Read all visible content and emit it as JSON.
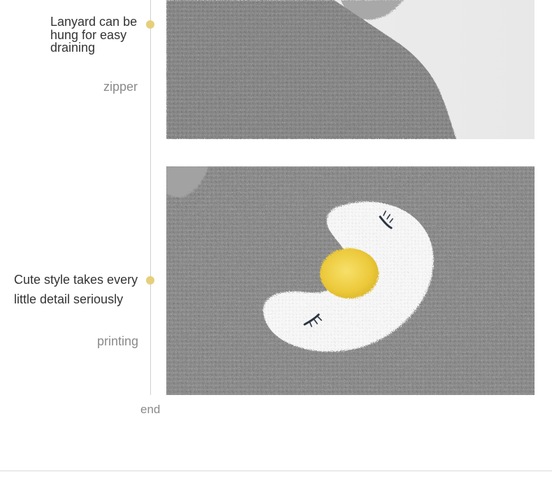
{
  "sections": [
    {
      "caption": "Lanyard can be hung for easy draining",
      "subcaption": "zipper",
      "photo_subject": "gray plush towel pouch with lanyard loop"
    },
    {
      "caption": "Cute style takes every little detail seriously",
      "subcaption": "printing",
      "photo_subject": "gray plush towel with white penguin face and yellow beak"
    }
  ],
  "end_label": "end",
  "colors": {
    "accent_dot": "#e6cf7a",
    "timeline": "#cfcfcf",
    "plush_gray": "#8c8c8c",
    "penguin_white": "#f7f7f7",
    "beak_yellow": "#f0d34a"
  }
}
